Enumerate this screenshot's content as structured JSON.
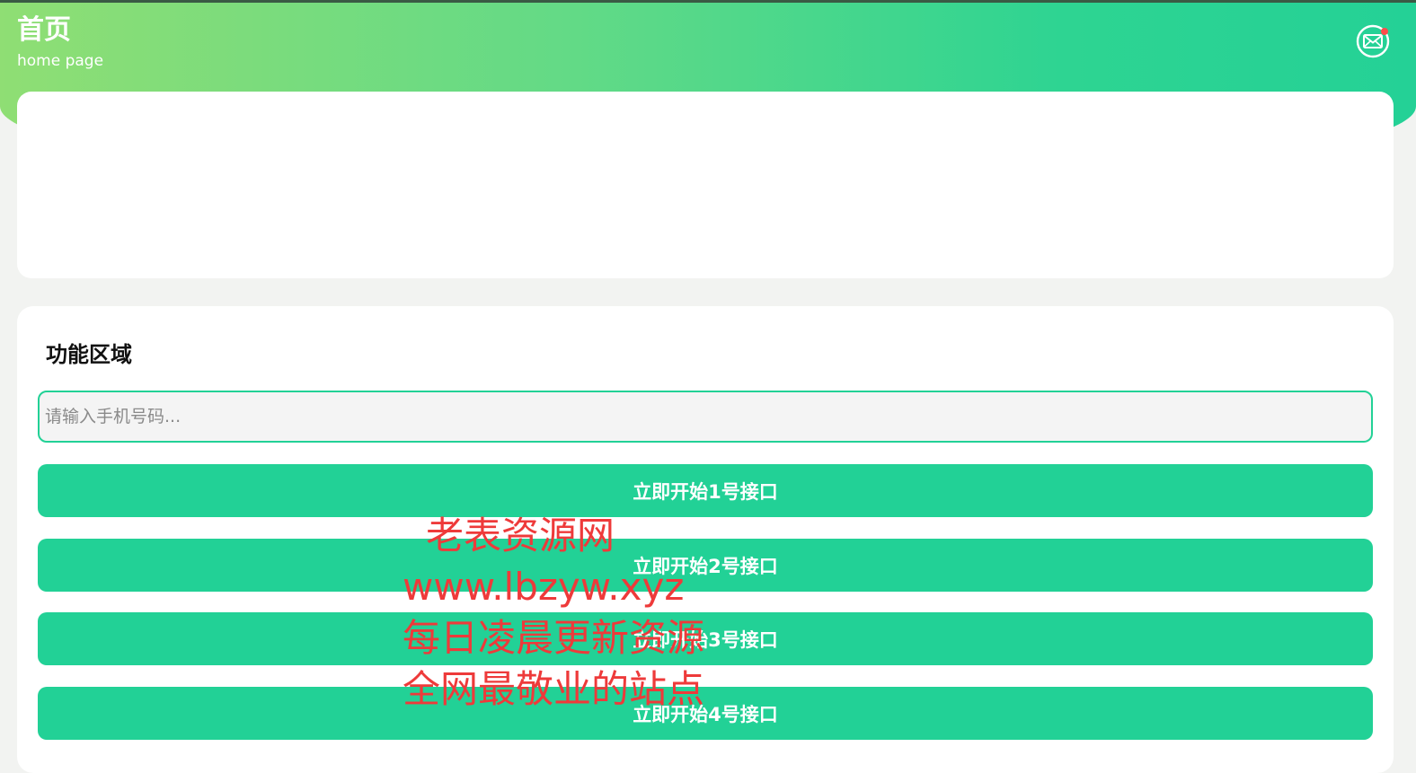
{
  "header": {
    "title": "首页",
    "subtitle": "home page",
    "mail_icon": "mail-icon",
    "mail_badge_icon": "notification-dot-icon"
  },
  "function_area": {
    "title": "功能区域",
    "phone_input": {
      "value": "",
      "placeholder": "请输入手机号码..."
    },
    "buttons": [
      {
        "label": "立即开始1号接口"
      },
      {
        "label": "立即开始2号接口"
      },
      {
        "label": "立即开始3号接口"
      },
      {
        "label": "立即开始4号接口"
      }
    ]
  },
  "watermark": {
    "lines": [
      "老表资源网",
      "www.lbzyw.xyz",
      "每日凌晨更新资源",
      "全网最敬业的站点"
    ]
  },
  "colors": {
    "accent": "#22d196",
    "header_gradient_start": "#8fde74",
    "header_gradient_end": "#24d196",
    "watermark": "#ee3a3a",
    "page_background": "#f2f3f1"
  }
}
